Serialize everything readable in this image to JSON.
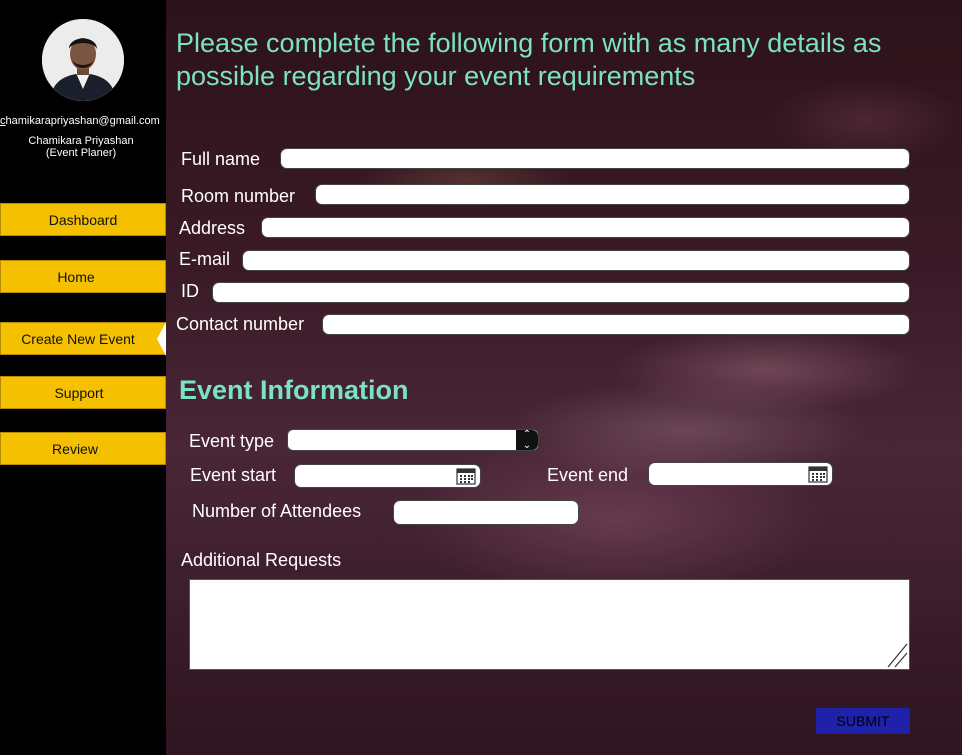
{
  "sidebar": {
    "email_prefix": "c",
    "email_rest": "hamikarapriyashan@gmail.com",
    "name": "Chamikara Priyashan",
    "role": "(Event Planer)",
    "nav": [
      {
        "label": "Dashboard"
      },
      {
        "label": "Home"
      },
      {
        "label": "Create New Event"
      },
      {
        "label": "Support"
      },
      {
        "label": "Review"
      }
    ],
    "active_index": 2,
    "accent": "#f5c000"
  },
  "form": {
    "heading": "Please complete the following form with as many details as possible regarding your event requirements",
    "personal": {
      "full_name": {
        "label": "Full name",
        "value": ""
      },
      "room_number": {
        "label": "Room number",
        "value": ""
      },
      "address": {
        "label": "Address",
        "value": ""
      },
      "email": {
        "label": "E-mail",
        "value": ""
      },
      "id": {
        "label": "ID",
        "value": ""
      },
      "contact": {
        "label": "Contact number",
        "value": ""
      }
    },
    "event_section_title": "Event Information",
    "event": {
      "type_label": "Event type",
      "start_label": "Event start",
      "end_label": "Event end",
      "attendees_label": "Number of Attendees",
      "additional_label": "Additional Requests"
    },
    "submit_label": "SUBMIT"
  },
  "colors": {
    "heading": "#7be3c2",
    "submit_bg": "#1f22a8"
  }
}
